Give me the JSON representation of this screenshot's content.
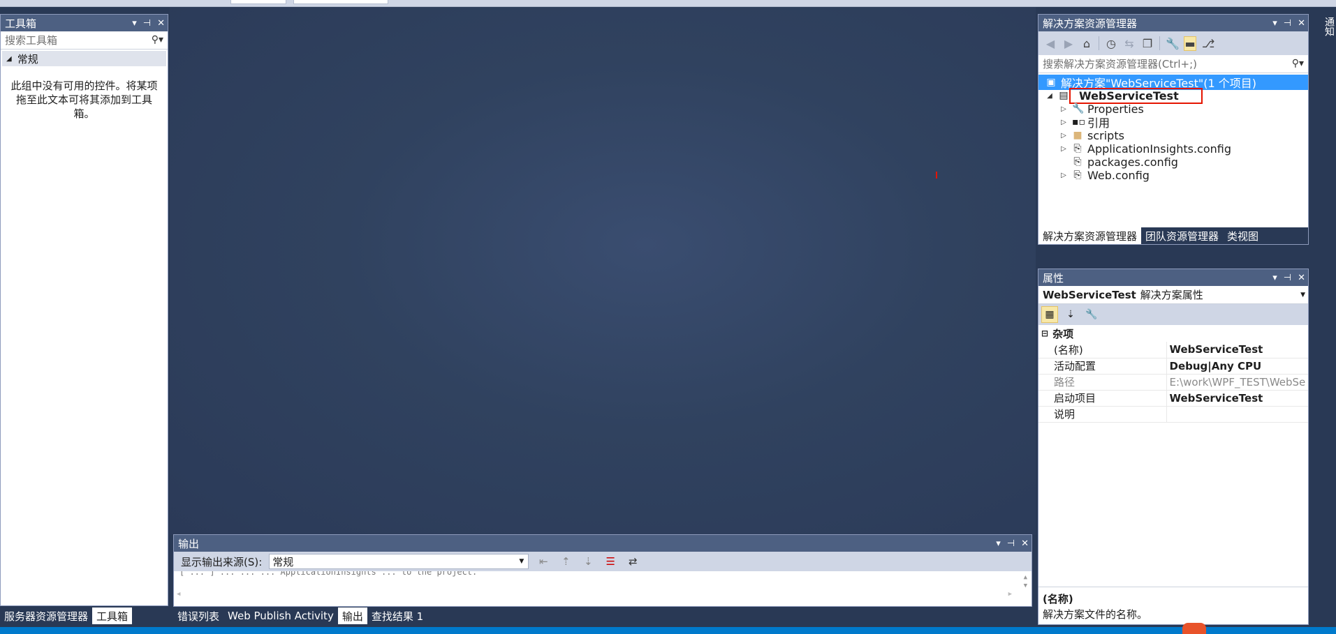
{
  "toolbox": {
    "title": "工具箱",
    "search_placeholder": "搜索工具箱",
    "group": "常规",
    "empty_message": "此组中没有可用的控件。将某项拖至此文本可将其添加到工具箱。"
  },
  "left_tabs": [
    "服务器资源管理器",
    "工具箱"
  ],
  "solution_explorer": {
    "title": "解决方案资源管理器",
    "search_placeholder": "搜索解决方案资源管理器(Ctrl+;)",
    "tree": [
      {
        "label": "解决方案\"WebServiceTest\"(1 个项目)",
        "icon": "solution-icon"
      },
      {
        "label": "WebServiceTest",
        "icon": "web-project-icon"
      },
      {
        "label": "Properties",
        "icon": "wrench-icon"
      },
      {
        "label": "引用",
        "icon": "references-icon"
      },
      {
        "label": "scripts",
        "icon": "folder-icon"
      },
      {
        "label": "ApplicationInsights.config",
        "icon": "config-file-icon"
      },
      {
        "label": "packages.config",
        "icon": "config-file-icon"
      },
      {
        "label": "Web.config",
        "icon": "config-file-icon"
      }
    ],
    "tabs": [
      "解决方案资源管理器",
      "团队资源管理器",
      "类视图"
    ]
  },
  "properties": {
    "title": "属性",
    "object_name": "WebServiceTest",
    "object_type": "解决方案属性",
    "category": "杂项",
    "rows": [
      {
        "name": "(名称)",
        "value": "WebServiceTest"
      },
      {
        "name": "活动配置",
        "value": "Debug|Any CPU"
      },
      {
        "name": "路径",
        "value": "E:\\work\\WPF_TEST\\WebSe"
      },
      {
        "name": "启动项目",
        "value": "WebServiceTest"
      },
      {
        "name": "说明",
        "value": ""
      }
    ],
    "desc_title": "(名称)",
    "desc_text": "解决方案文件的名称。"
  },
  "output": {
    "title": "输出",
    "source_label": "显示输出来源(S):",
    "source_value": "常规",
    "text": "[ ... ] ... ... ... ApplicationInsights ... to the project."
  },
  "bottom_tabs": [
    "错误列表",
    "Web Publish Activity",
    "输出",
    "查找结果 1"
  ],
  "notification_tab": "通知",
  "colors": {
    "title_bar": "#4d6082",
    "selection": "#3399ff",
    "status_bar": "#007acc",
    "highlight_box": "#e51400"
  }
}
